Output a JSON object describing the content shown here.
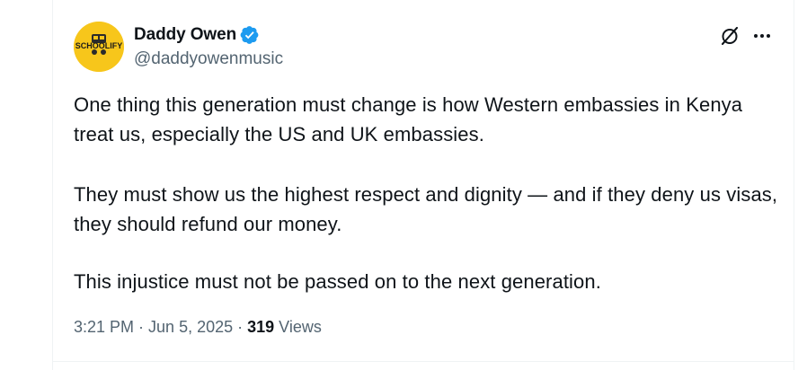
{
  "author": {
    "display_name": "Daddy Owen",
    "handle": "@daddyowenmusic",
    "avatar_text": "SCHOOLIFY",
    "verified": true
  },
  "tweet": {
    "paragraph_1": "One thing this generation must change is how Western embassies in Kenya treat us, especially the US and UK embassies.",
    "paragraph_2": "They must show us the highest respect and dignity — and if they deny us visas, they should refund our money.",
    "paragraph_3": "This injustice must not be passed on to the next generation."
  },
  "meta": {
    "time": "3:21 PM",
    "separator_1": " · ",
    "date": "Jun 5, 2025",
    "separator_2": " · ",
    "views_count": "319",
    "views_label": " Views"
  },
  "icons": {
    "grok": "grok-icon",
    "more": "more-icon",
    "verified": "verified-badge-icon"
  },
  "colors": {
    "text_primary": "#0f1419",
    "text_secondary": "#536471",
    "verified_blue": "#1d9bf0",
    "avatar_bg": "#f7c61b"
  }
}
